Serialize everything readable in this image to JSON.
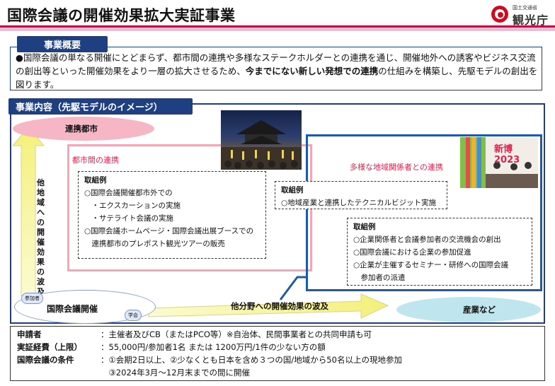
{
  "header": {
    "title": "国際会議の開催効果拡大実証事業",
    "logo_small": "国土交通省",
    "logo_name": "観光庁"
  },
  "overview": {
    "heading": "事業概要",
    "text_before": "●国際会議の単なる開催にとどまらず、都市間の連携や多様なステークホルダーとの連携を通じ、開催地外への誘客やビジネス交流の創出等といった開催効果をより一層の拡大させるため、",
    "text_bold": "今までにない新しい発想での連携",
    "text_after": "の仕組みを構築し、先駆モデルの創出を図ります。"
  },
  "content": {
    "heading": "事業内容（先駆モデルのイメージ）",
    "city_label": "連携都市",
    "industry_label": "産業など",
    "conference_label": "国際会議開催",
    "participant_tag": "参加者",
    "society_tag": "学会",
    "vertical_label": "他地域への開催効果の波及",
    "horizontal_label": "他分野への開催効果の波及",
    "intercity_label": "都市間の連携",
    "stakeholder_label": "多様な地域関係者との連携",
    "box1": {
      "heading": "取組例",
      "items": [
        "○国際会議開催都市外での",
        "　・エクスカーションの実施",
        "　・サテライト会議の実施",
        "○国際会議ホームページ・国際会議出展ブースでの",
        "　連携都市のプレポスト観光ツアーの販売"
      ]
    },
    "box2": {
      "heading": "取組例",
      "items": [
        "○地域産業と連携したテクニカルビジット実施"
      ]
    },
    "box3": {
      "heading": "取組例",
      "items": [
        "○企業関係者と会議参加者の交流機会の創出",
        "○国際会議における企業の参加促進",
        "○企業が主催するセミナー・研修への国際会議",
        "　参加者の派遣"
      ]
    },
    "photo2_sign": "新博2023"
  },
  "footer": {
    "rows": [
      {
        "key": "申請者",
        "value": "：主催者及びCB（またはPCO等）※自治体、民間事業者との共同申請も可"
      },
      {
        "key": "実証経費（上限）",
        "value": "：55,000円/参加者1名 または 1200万円/1件の少ない方の額"
      },
      {
        "key": "国際会議の条件",
        "value": "：①会期2日以上、②少なくとも日本を含め３つの国/地域から50名以上の現地参加"
      },
      {
        "key": "",
        "value": "　③2024年3月～12月末までの間に開催"
      }
    ]
  },
  "colors": {
    "navy": "#1e3f82",
    "red_frame": "#f3a6b6",
    "blue_frame": "#1f5aa6",
    "accent_red": "#e0234e"
  }
}
